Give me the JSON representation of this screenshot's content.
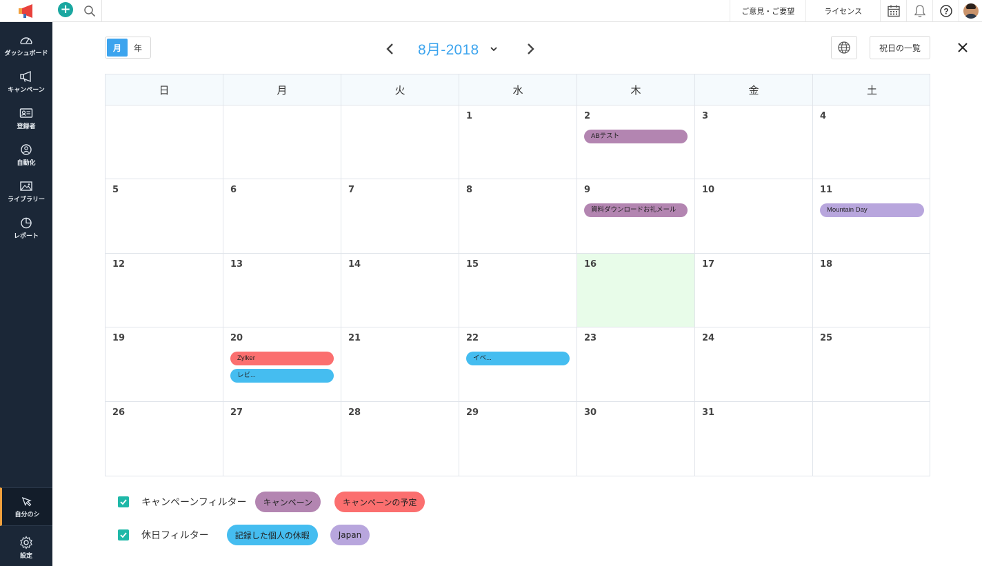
{
  "topbar": {
    "feedback_label": "ご意見・ご要望",
    "license_label": "ライセンス",
    "help_label": "?"
  },
  "sidebar": {
    "items": [
      {
        "label": "ダッシュボード",
        "icon": "dashboard-icon"
      },
      {
        "label": "キャンペーン",
        "icon": "megaphone-icon"
      },
      {
        "label": "登録者",
        "icon": "contact-card-icon"
      },
      {
        "label": "自動化",
        "icon": "automation-icon"
      },
      {
        "label": "ライブラリー",
        "icon": "image-icon"
      },
      {
        "label": "レポート",
        "icon": "pie-chart-icon"
      }
    ],
    "bottom": [
      {
        "label": "自分のシ",
        "icon": "pointer-icon"
      },
      {
        "label": "設定",
        "icon": "gear-icon"
      }
    ]
  },
  "header": {
    "view_month": "月",
    "view_year": "年",
    "month_title": "8月-2018",
    "holiday_list_label": "祝日の一覧"
  },
  "calendar": {
    "weekdays": [
      "日",
      "月",
      "火",
      "水",
      "木",
      "金",
      "土"
    ],
    "weeks": [
      [
        {
          "day": "",
          "events": []
        },
        {
          "day": "",
          "events": []
        },
        {
          "day": "",
          "events": []
        },
        {
          "day": "1",
          "events": []
        },
        {
          "day": "2",
          "events": [
            {
              "label": "ABテスト",
              "color": "#b385b1"
            }
          ]
        },
        {
          "day": "3",
          "events": []
        },
        {
          "day": "4",
          "events": []
        }
      ],
      [
        {
          "day": "5",
          "events": []
        },
        {
          "day": "6",
          "events": []
        },
        {
          "day": "7",
          "events": []
        },
        {
          "day": "8",
          "events": []
        },
        {
          "day": "9",
          "events": [
            {
              "label": "資料ダウンロードお礼メール",
              "color": "#b385b1"
            }
          ]
        },
        {
          "day": "10",
          "events": []
        },
        {
          "day": "11",
          "events": [
            {
              "label": "Mountain Day",
              "color": "#b8a6dd"
            }
          ]
        }
      ],
      [
        {
          "day": "12",
          "events": []
        },
        {
          "day": "13",
          "events": []
        },
        {
          "day": "14",
          "events": []
        },
        {
          "day": "15",
          "events": []
        },
        {
          "day": "16",
          "today": true,
          "events": []
        },
        {
          "day": "17",
          "events": []
        },
        {
          "day": "18",
          "events": []
        }
      ],
      [
        {
          "day": "19",
          "events": []
        },
        {
          "day": "20",
          "events": [
            {
              "label": "Zylker",
              "color": "#fb6f6f"
            },
            {
              "label": "レビ...",
              "color": "#45bdf0"
            }
          ]
        },
        {
          "day": "21",
          "events": []
        },
        {
          "day": "22",
          "events": [
            {
              "label": "イベ...",
              "color": "#45bdf0"
            }
          ]
        },
        {
          "day": "23",
          "events": []
        },
        {
          "day": "24",
          "events": []
        },
        {
          "day": "25",
          "events": []
        }
      ],
      [
        {
          "day": "26",
          "events": []
        },
        {
          "day": "27",
          "events": []
        },
        {
          "day": "28",
          "events": []
        },
        {
          "day": "29",
          "events": []
        },
        {
          "day": "30",
          "events": []
        },
        {
          "day": "31",
          "events": []
        },
        {
          "day": "",
          "events": []
        }
      ]
    ]
  },
  "filters": {
    "campaign": {
      "label": "キャンペーンフィルター",
      "tags": [
        {
          "label": "キャンペーン",
          "color": "#b385b1"
        },
        {
          "label": "キャンペーンの予定",
          "color": "#fb6f6f"
        }
      ]
    },
    "holiday": {
      "label": "休日フィルター",
      "tags": [
        {
          "label": "記録した個人の休暇",
          "color": "#45bdf0"
        },
        {
          "label": "Japan",
          "color": "#b8a6dd"
        }
      ]
    }
  }
}
